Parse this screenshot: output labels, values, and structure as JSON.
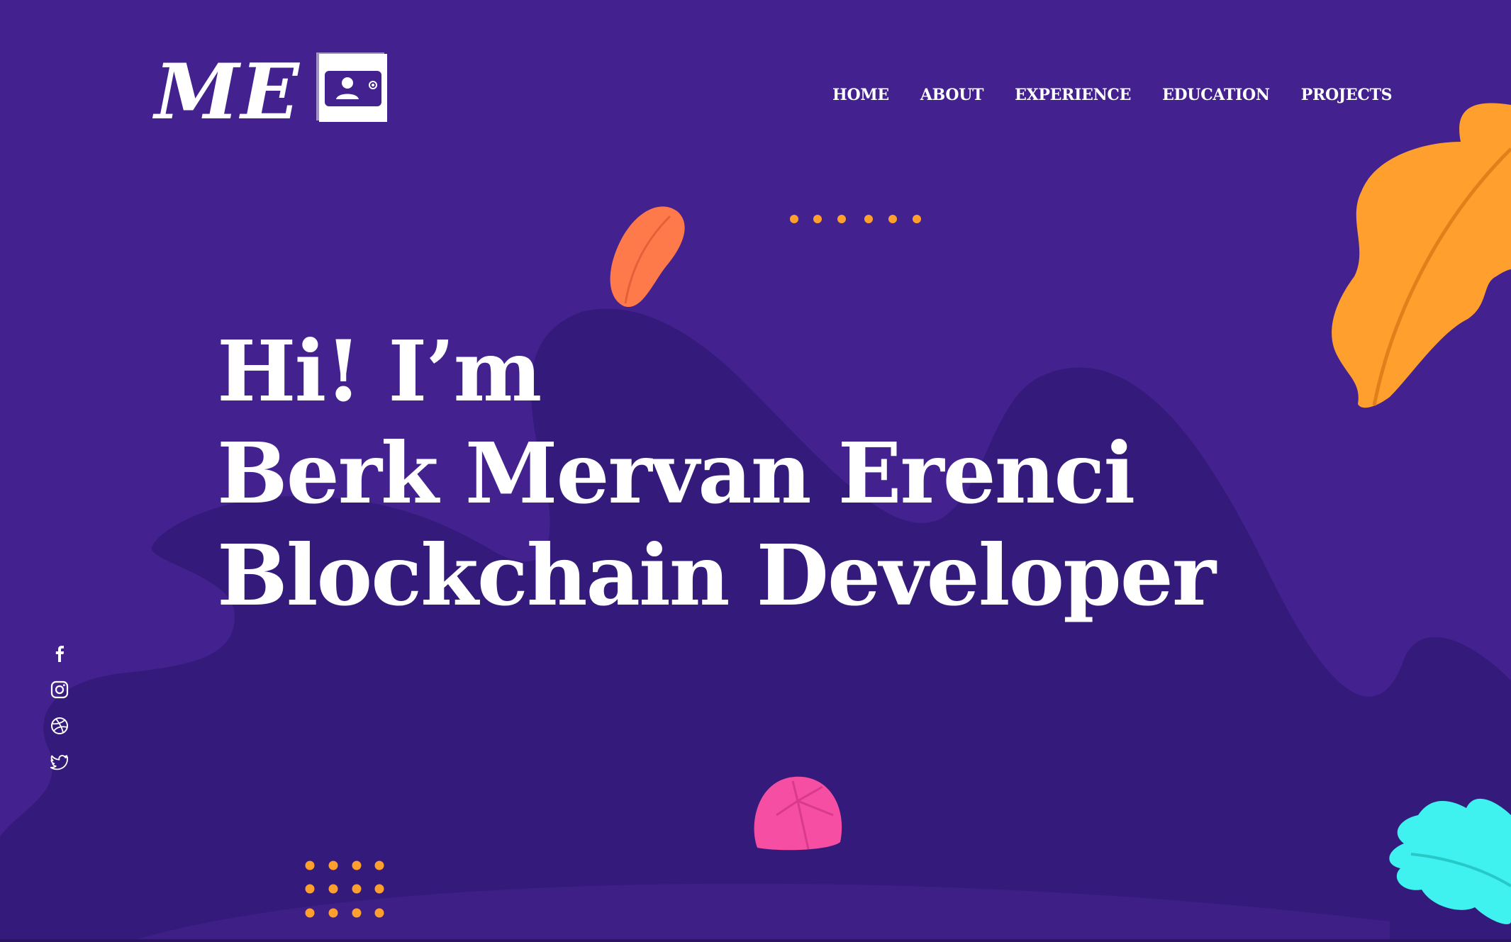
{
  "logo": {
    "text": "ME",
    "icon": "id-card-icon"
  },
  "nav": {
    "items": [
      {
        "label": "HOME"
      },
      {
        "label": "ABOUT"
      },
      {
        "label": "EXPERIENCE"
      },
      {
        "label": "EDUCATION"
      },
      {
        "label": "PROJECTS"
      }
    ]
  },
  "hero": {
    "line1": "Hi! I’m",
    "line2": "Berk Mervan Erenci",
    "line3": "Blockchain Developer"
  },
  "social": {
    "icons": [
      "facebook-icon",
      "instagram-icon",
      "dribbble-icon",
      "twitter-icon"
    ]
  },
  "colors": {
    "background": "#43228f",
    "blob_dark": "#341a7a",
    "orange_leaf": "#ff9f2d",
    "coral_leaf": "#ff7a4a",
    "pink_shape": "#f54ea3",
    "cyan_leaf": "#3ff1ef",
    "dots": "#ff9f2d",
    "text": "#ffffff"
  }
}
